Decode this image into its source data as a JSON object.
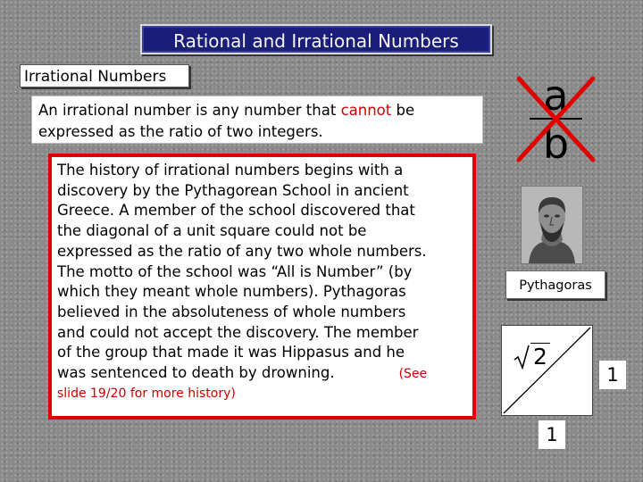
{
  "title": "Rational and Irrational Numbers",
  "subtitle": "Irrational Numbers",
  "definition": {
    "line1_before": "An irrational number is any number that ",
    "line1_emphasis": "cannot",
    "line1_after": " be",
    "line2": "expressed as the ratio of two integers."
  },
  "history": {
    "lines": [
      "The history of irrational numbers begins with a",
      "discovery by the Pythagorean School in ancient",
      "Greece. A member of the school discovered that",
      "the diagonal of a unit square could not be",
      "expressed as the ratio of any two whole numbers.",
      "The motto of the school was “All is Number” (by",
      "which they meant whole numbers). Pythagoras",
      "believed in the absoluteness of whole numbers",
      "and could not accept the discovery. The member",
      "of the group that made it was Hippasus and he",
      "was sentenced to death by drowning."
    ],
    "see_start": "(See",
    "see_end": "slide 19/20 for more history)"
  },
  "fraction": {
    "numerator": "a",
    "denominator": "b"
  },
  "portrait_caption": "Pythagoras",
  "square": {
    "diagonal_label": "2",
    "side_label_right": "1",
    "side_label_bottom": "1"
  },
  "colors": {
    "title_bg": "#1a1e78",
    "emphasis_red": "#cc0000",
    "box_border_red": "#e00000",
    "cross_red": "#e00000"
  },
  "icons": {
    "portrait": "bust-portrait-icon",
    "cross": "red-x-cross-icon",
    "radical": "square-root-symbol"
  }
}
